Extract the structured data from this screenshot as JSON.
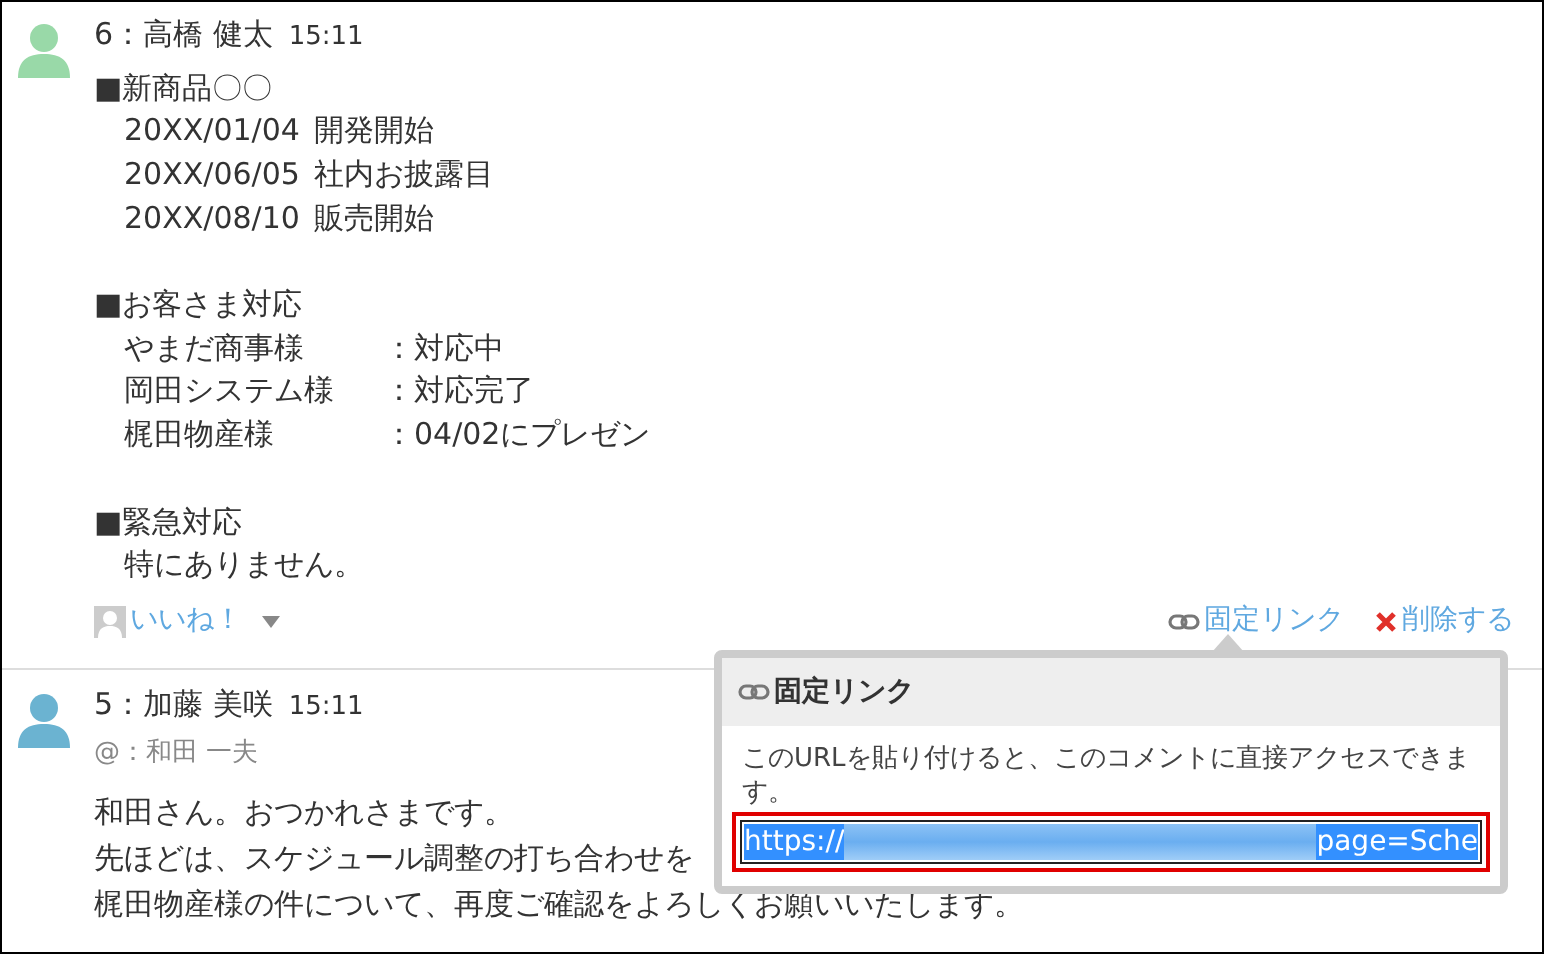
{
  "comments": [
    {
      "author": "6：高橋 健太",
      "time": "15:11",
      "sections": [
        {
          "title": "■新商品〇〇",
          "rows": [
            {
              "kind": "pair",
              "cells": [
                "20XX/01/04",
                "開発開始"
              ]
            },
            {
              "kind": "pair",
              "cells": [
                "20XX/06/05",
                "社内お披露目"
              ]
            },
            {
              "kind": "pair",
              "cells": [
                "20XX/08/10",
                "販売開始"
              ]
            }
          ]
        },
        {
          "title": "■お客さま対応",
          "rows": [
            {
              "kind": "status",
              "cells": [
                "やまだ商事様",
                "：対応中"
              ]
            },
            {
              "kind": "status",
              "cells": [
                "岡田システム様",
                "：対応完了"
              ]
            },
            {
              "kind": "status",
              "cells": [
                "梶田物産様",
                "：04/02にプレゼン"
              ]
            }
          ]
        },
        {
          "title": "■緊急対応",
          "rows": [
            {
              "kind": "line",
              "cells": [
                "特にありません。"
              ]
            }
          ]
        }
      ],
      "like": "いいね！",
      "permalink": "固定リンク",
      "delete": "削除する"
    },
    {
      "author": "5：加藤 美咲",
      "time": "15:11",
      "mention": "@：和田 一夫",
      "lines": [
        "和田さん。おつかれさまです。",
        "先ほどは、スケジュール調整の打ち合わせを",
        "梶田物産様の件について、再度ご確認をよろしくお願いいたします。"
      ]
    }
  ],
  "popup": {
    "title": "固定リンク",
    "message": "このURLを貼り付けると、このコメントに直接アクセスできます。",
    "url_start": "https://",
    "url_end": "page=Sche"
  }
}
